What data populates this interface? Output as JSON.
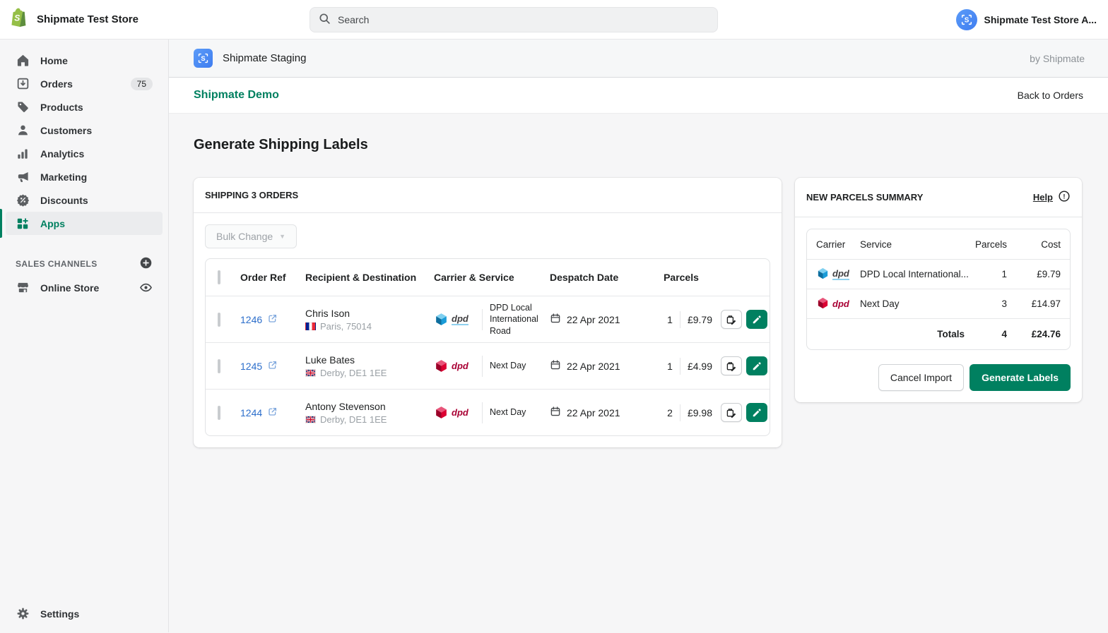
{
  "topbar": {
    "store_name": "Shipmate Test Store",
    "search_placeholder": "Search",
    "account_label": "Shipmate Test Store A..."
  },
  "sidebar": {
    "items": [
      {
        "label": "Home",
        "icon": "home-icon"
      },
      {
        "label": "Orders",
        "icon": "orders-icon",
        "badge": "75"
      },
      {
        "label": "Products",
        "icon": "tag-icon"
      },
      {
        "label": "Customers",
        "icon": "customers-icon"
      },
      {
        "label": "Analytics",
        "icon": "analytics-icon"
      },
      {
        "label": "Marketing",
        "icon": "megaphone-icon"
      },
      {
        "label": "Discounts",
        "icon": "discount-icon"
      },
      {
        "label": "Apps",
        "icon": "apps-icon",
        "active": true
      }
    ],
    "sales_channels_label": "SALES CHANNELS",
    "online_store_label": "Online Store",
    "settings_label": "Settings"
  },
  "app_header": {
    "app_name": "Shipmate Staging",
    "byline": "by Shipmate"
  },
  "page_nav": {
    "title": "Shipmate Demo",
    "back_link": "Back to Orders"
  },
  "page": {
    "heading": "Generate Shipping Labels"
  },
  "orders_card": {
    "title": "SHIPPING 3 ORDERS",
    "bulk_change_label": "Bulk Change",
    "columns": [
      "Order Ref",
      "Recipient & Destination",
      "Carrier & Service",
      "Despatch Date",
      "Parcels"
    ],
    "rows": [
      {
        "order_ref": "1246",
        "recipient": "Chris Ison",
        "destination": "Paris, 75014",
        "country": "FR",
        "carrier": "dpd",
        "carrier_variant": "blue",
        "service": "DPD Local International Road",
        "despatch_date": "22 Apr 2021",
        "parcels": "1",
        "cost": "£9.79"
      },
      {
        "order_ref": "1245",
        "recipient": "Luke Bates",
        "destination": "Derby, DE1 1EE",
        "country": "GB",
        "carrier": "dpd",
        "carrier_variant": "red",
        "service": "Next Day",
        "despatch_date": "22 Apr 2021",
        "parcels": "1",
        "cost": "£4.99"
      },
      {
        "order_ref": "1244",
        "recipient": "Antony Stevenson",
        "destination": "Derby, DE1 1EE",
        "country": "GB",
        "carrier": "dpd",
        "carrier_variant": "red",
        "service": "Next Day",
        "despatch_date": "22 Apr 2021",
        "parcels": "2",
        "cost": "£9.98"
      }
    ]
  },
  "summary_card": {
    "title": "NEW PARCELS SUMMARY",
    "help_label": "Help",
    "columns": [
      "Carrier",
      "Service",
      "Parcels",
      "Cost"
    ],
    "rows": [
      {
        "carrier": "dpd",
        "carrier_variant": "blue",
        "service": "DPD Local International...",
        "parcels": "1",
        "cost": "£9.79"
      },
      {
        "carrier": "dpd",
        "carrier_variant": "red",
        "service": "Next Day",
        "parcels": "3",
        "cost": "£14.97"
      }
    ],
    "totals": {
      "label": "Totals",
      "parcels": "4",
      "cost": "£24.76"
    },
    "cancel_label": "Cancel Import",
    "generate_label": "Generate Labels"
  },
  "colors": {
    "accent_green": "#008060",
    "link_blue": "#2c6ecb",
    "dpd_red": "#dc0032",
    "dpd_blue": "#1a9cd8",
    "shipmate_blue": "#4285f4",
    "shopify_green": "#95bf47"
  }
}
